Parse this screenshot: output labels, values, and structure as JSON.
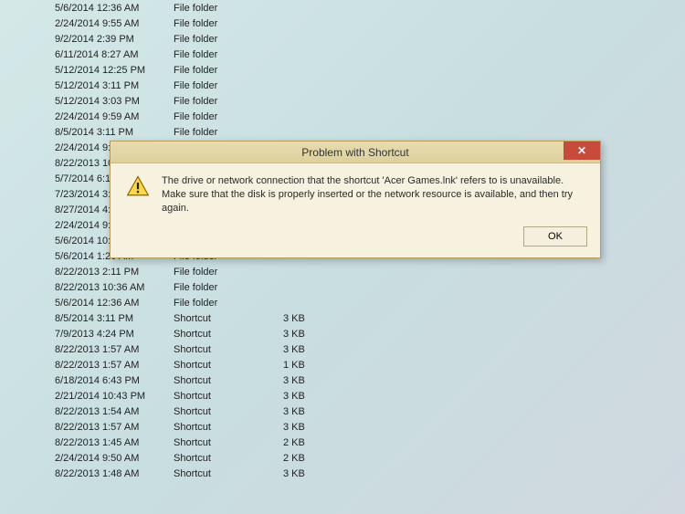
{
  "files": [
    {
      "date": "5/6/2014 12:36 AM",
      "type": "File folder",
      "size": ""
    },
    {
      "date": "2/24/2014 9:55 AM",
      "type": "File folder",
      "size": ""
    },
    {
      "date": "9/2/2014 2:39 PM",
      "type": "File folder",
      "size": ""
    },
    {
      "date": "6/11/2014 8:27 AM",
      "type": "File folder",
      "size": ""
    },
    {
      "date": "5/12/2014 12:25 PM",
      "type": "File folder",
      "size": ""
    },
    {
      "date": "5/12/2014 3:11 PM",
      "type": "File folder",
      "size": ""
    },
    {
      "date": "5/12/2014 3:03 PM",
      "type": "File folder",
      "size": ""
    },
    {
      "date": "2/24/2014 9:59 AM",
      "type": "File folder",
      "size": ""
    },
    {
      "date": "8/5/2014 3:11 PM",
      "type": "File folder",
      "size": ""
    },
    {
      "date": "2/24/2014 9:",
      "type": "",
      "size": ""
    },
    {
      "date": "8/22/2013 10:",
      "type": "",
      "size": ""
    },
    {
      "date": "5/7/2014 6:11",
      "type": "",
      "size": ""
    },
    {
      "date": "7/23/2014 3:0",
      "type": "",
      "size": ""
    },
    {
      "date": "8/27/2014 4:",
      "type": "",
      "size": ""
    },
    {
      "date": "2/24/2014 9:",
      "type": "",
      "size": ""
    },
    {
      "date": "5/6/2014 10:",
      "type": "",
      "size": ""
    },
    {
      "date": "5/6/2014 1:26 AM",
      "type": "File folder",
      "size": ""
    },
    {
      "date": "8/22/2013 2:11 PM",
      "type": "File folder",
      "size": ""
    },
    {
      "date": "8/22/2013 10:36 AM",
      "type": "File folder",
      "size": ""
    },
    {
      "date": "5/6/2014 12:36 AM",
      "type": "File folder",
      "size": ""
    },
    {
      "date": "8/5/2014 3:11 PM",
      "type": "Shortcut",
      "size": "3 KB"
    },
    {
      "date": "7/9/2013 4:24 PM",
      "type": "Shortcut",
      "size": "3 KB"
    },
    {
      "date": "8/22/2013 1:57 AM",
      "type": "Shortcut",
      "size": "3 KB"
    },
    {
      "date": "8/22/2013 1:57 AM",
      "type": "Shortcut",
      "size": "1 KB"
    },
    {
      "date": "6/18/2014 6:43 PM",
      "type": "Shortcut",
      "size": "3 KB"
    },
    {
      "date": "2/21/2014 10:43 PM",
      "type": "Shortcut",
      "size": "3 KB"
    },
    {
      "date": "8/22/2013 1:54 AM",
      "type": "Shortcut",
      "size": "3 KB"
    },
    {
      "date": "8/22/2013 1:57 AM",
      "type": "Shortcut",
      "size": "3 KB"
    },
    {
      "date": "8/22/2013 1:45 AM",
      "type": "Shortcut",
      "size": "2 KB"
    },
    {
      "date": "2/24/2014 9:50 AM",
      "type": "Shortcut",
      "size": "2 KB"
    },
    {
      "date": "8/22/2013 1:48 AM",
      "type": "Shortcut",
      "size": "3 KB"
    }
  ],
  "dialog": {
    "title": "Problem with Shortcut",
    "message": "The drive or network connection that the shortcut 'Acer Games.lnk' refers to is unavailable. Make sure that the disk is properly inserted or the network resource is available, and then try again.",
    "ok_label": "OK",
    "close_glyph": "✕"
  }
}
